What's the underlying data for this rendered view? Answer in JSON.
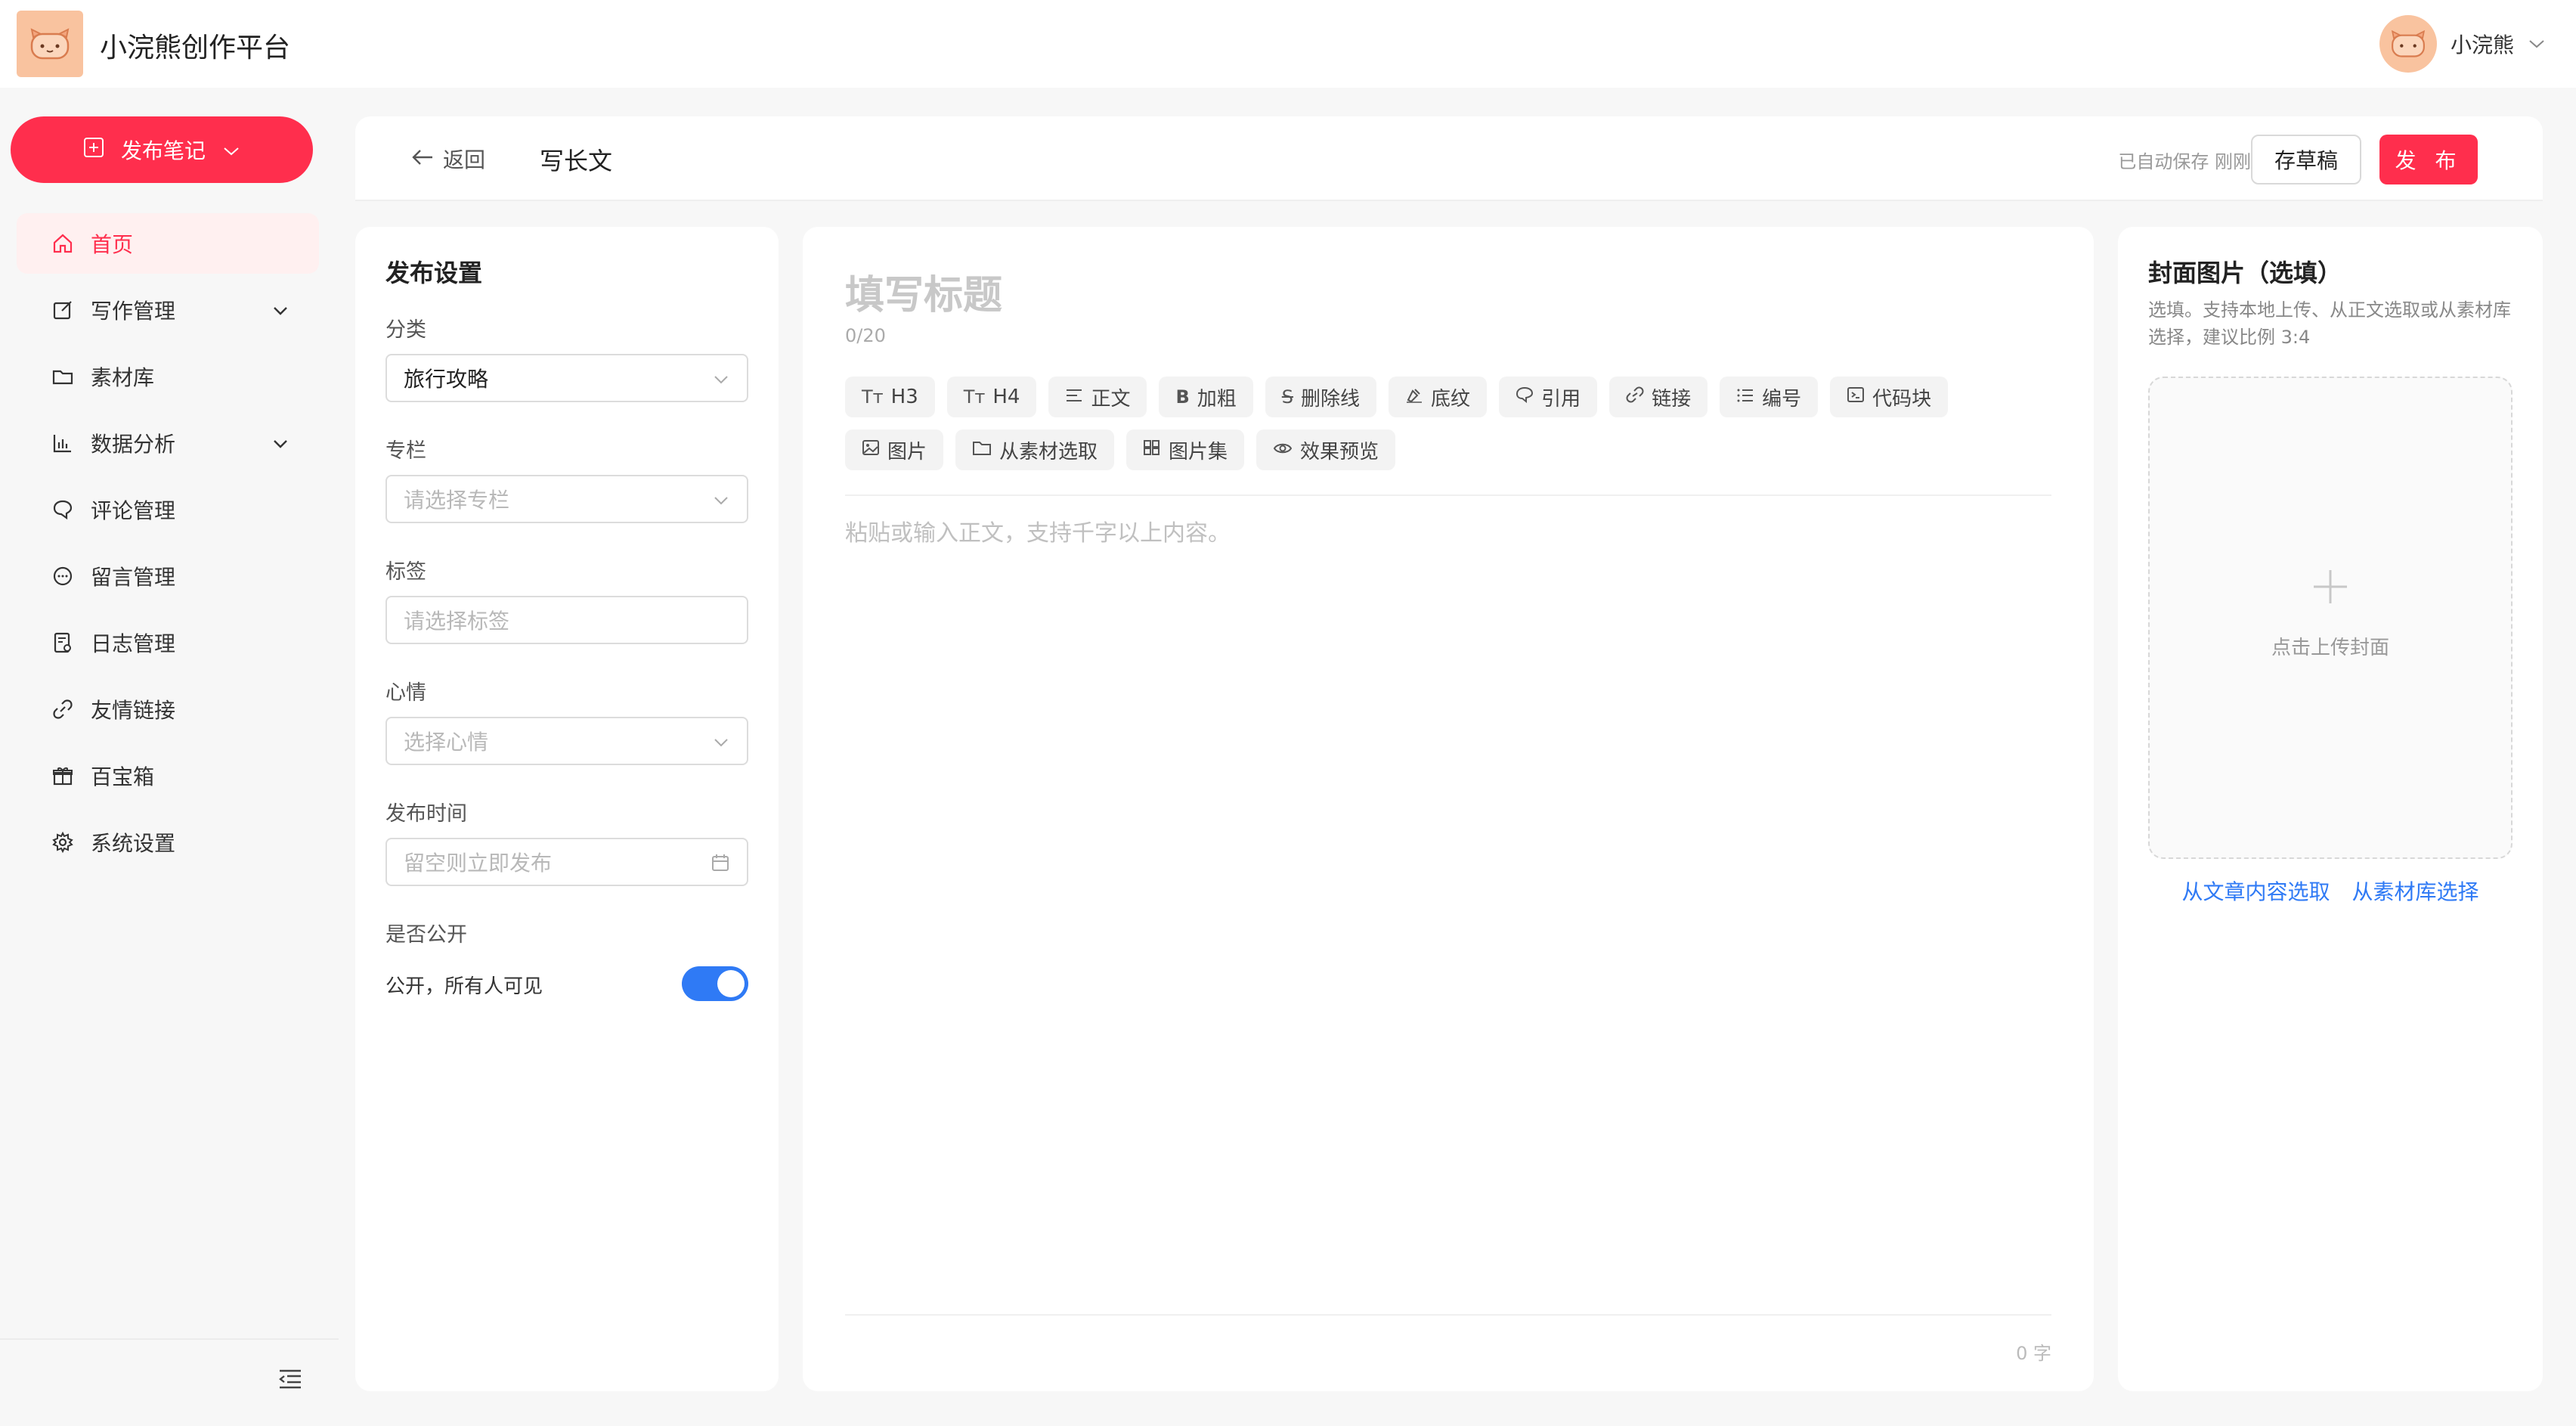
{
  "header": {
    "app_title": "小浣熊创作平台",
    "user_name": "小浣熊"
  },
  "sidebar": {
    "publish_label": "发布笔记",
    "items": [
      {
        "label": "首页",
        "icon": "home-icon",
        "active": true
      },
      {
        "label": "写作管理",
        "icon": "edit-icon",
        "has_caret": true
      },
      {
        "label": "素材库",
        "icon": "folder-icon"
      },
      {
        "label": "数据分析",
        "icon": "bar-chart-icon",
        "has_caret": true
      },
      {
        "label": "评论管理",
        "icon": "comment-icon"
      },
      {
        "label": "留言管理",
        "icon": "message-icon"
      },
      {
        "label": "日志管理",
        "icon": "log-icon"
      },
      {
        "label": "友情链接",
        "icon": "link-icon"
      },
      {
        "label": "百宝箱",
        "icon": "gift-icon"
      },
      {
        "label": "系统设置",
        "icon": "gear-icon"
      }
    ]
  },
  "editor_header": {
    "back_label": "返回",
    "page_title": "写长文",
    "autosave_text": "已自动保存 刚刚",
    "draft_label": "存草稿",
    "publish_label": "发 布"
  },
  "settings": {
    "title": "发布设置",
    "category_label": "分类",
    "category_value": "旅行攻略",
    "column_label": "专栏",
    "column_placeholder": "请选择专栏",
    "tags_label": "标签",
    "tags_placeholder": "请选择标签",
    "mood_label": "心情",
    "mood_placeholder": "选择心情",
    "time_label": "发布时间",
    "time_placeholder": "留空则立即发布",
    "public_label": "是否公开",
    "public_desc": "公开，所有人可见",
    "public_on": true
  },
  "editor": {
    "title_placeholder": "填写标题",
    "title_count": "0/20",
    "toolbar_row1": [
      {
        "label": "H3",
        "icon": "text-size-icon"
      },
      {
        "label": "H4",
        "icon": "text-size-icon"
      },
      {
        "label": "正文",
        "icon": "paragraph-icon"
      },
      {
        "label": "加粗",
        "icon": "bold-icon"
      },
      {
        "label": "删除线",
        "icon": "strikethrough-icon"
      },
      {
        "label": "底纹",
        "icon": "highlight-icon"
      },
      {
        "label": "引用",
        "icon": "quote-icon"
      },
      {
        "label": "链接",
        "icon": "link-icon"
      },
      {
        "label": "编号",
        "icon": "list-icon"
      },
      {
        "label": "代码块",
        "icon": "code-icon"
      }
    ],
    "toolbar_row2": [
      {
        "label": "图片",
        "icon": "image-icon"
      },
      {
        "label": "从素材选取",
        "icon": "folder-icon"
      },
      {
        "label": "图片集",
        "icon": "grid-icon"
      },
      {
        "label": "效果预览",
        "icon": "eye-icon"
      }
    ],
    "body_placeholder": "粘贴或输入正文，支持千字以上内容。",
    "word_count": "0 字"
  },
  "cover": {
    "title": "封面图片（选填）",
    "desc": "选填。支持本地上传、从正文选取或从素材库选择，建议比例 3:4",
    "upload_text": "点击上传封面",
    "link_from_article": "从文章内容选取",
    "link_from_library": "从素材库选择"
  },
  "colors": {
    "accent": "#ff2e4d",
    "link": "#2f7af5",
    "avatar_bg": "#f9c39f"
  }
}
